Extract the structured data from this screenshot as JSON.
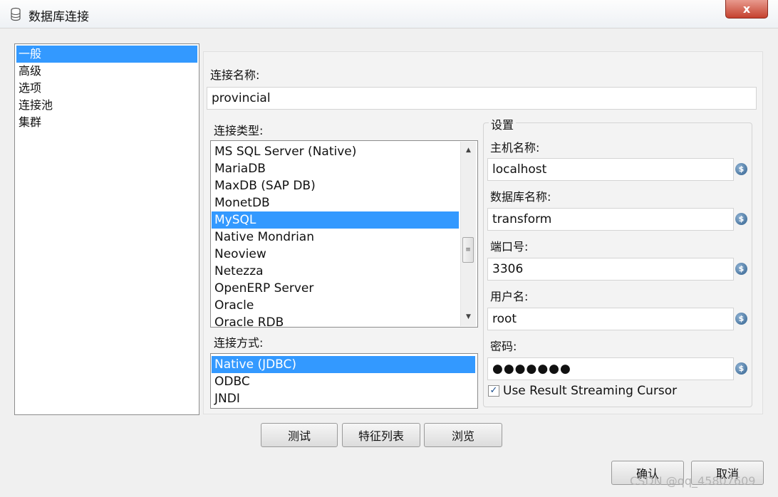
{
  "window": {
    "title": "数据库连接",
    "close_label": "x"
  },
  "sidebar": {
    "items": [
      {
        "label": "一般",
        "selected": true
      },
      {
        "label": "高级",
        "selected": false
      },
      {
        "label": "选项",
        "selected": false
      },
      {
        "label": "连接池",
        "selected": false
      },
      {
        "label": "集群",
        "selected": false
      }
    ]
  },
  "connection_name": {
    "label": "连接名称:",
    "value": "provincial"
  },
  "connection_type": {
    "label": "连接类型:",
    "items": [
      {
        "label": "MS SQL Server (Native)",
        "selected": false
      },
      {
        "label": "MariaDB",
        "selected": false
      },
      {
        "label": "MaxDB (SAP DB)",
        "selected": false
      },
      {
        "label": "MonetDB",
        "selected": false
      },
      {
        "label": "MySQL",
        "selected": true
      },
      {
        "label": "Native Mondrian",
        "selected": false
      },
      {
        "label": "Neoview",
        "selected": false
      },
      {
        "label": "Netezza",
        "selected": false
      },
      {
        "label": "OpenERP Server",
        "selected": false
      },
      {
        "label": "Oracle",
        "selected": false
      },
      {
        "label": "Oracle RDB",
        "selected": false
      }
    ]
  },
  "access_method": {
    "label": "连接方式:",
    "items": [
      {
        "label": "Native (JDBC)",
        "selected": true
      },
      {
        "label": "ODBC",
        "selected": false
      },
      {
        "label": "JNDI",
        "selected": false
      }
    ]
  },
  "settings": {
    "group_label": "设置",
    "host": {
      "label": "主机名称:",
      "value": "localhost"
    },
    "database": {
      "label": "数据库名称:",
      "value": "transform"
    },
    "port": {
      "label": "端口号:",
      "value": "3306"
    },
    "username": {
      "label": "用户名:",
      "value": "root"
    },
    "password": {
      "label": "密码:",
      "value": "●●●●●●●"
    },
    "streaming": {
      "label": "Use Result Streaming Cursor",
      "checked": true
    }
  },
  "variable_icon": "$",
  "action_buttons": {
    "test": "测试",
    "features": "特征列表",
    "explore": "浏览"
  },
  "dialog_buttons": {
    "ok": "确认",
    "cancel": "取消"
  },
  "watermark": "CSDN @qq_45807609",
  "colors": {
    "selection": "#3399ff",
    "close": "#c5412e"
  }
}
